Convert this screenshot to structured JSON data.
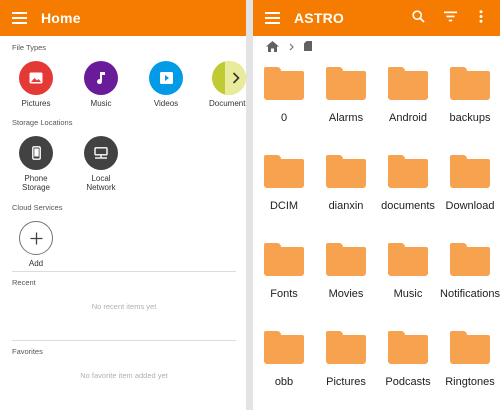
{
  "left_panel": {
    "title": "Home",
    "file_types_label": "File Types",
    "file_types": [
      {
        "label": "Pictures",
        "color": "#e53935",
        "icon": "image-icon"
      },
      {
        "label": "Music",
        "color": "#6a1b9a",
        "icon": "music-note-icon"
      },
      {
        "label": "Videos",
        "color": "#039be5",
        "icon": "play-icon"
      },
      {
        "label": "Documents",
        "color": "#c0ca33",
        "icon": "document-icon"
      }
    ],
    "storage_label": "Storage Locations",
    "storage": [
      {
        "label_line1": "Phone",
        "label_line2": "Storage",
        "icon": "phone-icon"
      },
      {
        "label_line1": "Local",
        "label_line2": "Network",
        "icon": "network-icon"
      }
    ],
    "cloud_label": "Cloud Services",
    "add_label": "Add",
    "recent_label": "Recent",
    "recent_empty": "No recent items yet",
    "favorites_label": "Favorites",
    "favorites_empty": "No favorite item added yet"
  },
  "right_panel": {
    "title": "ASTRO",
    "folders": [
      "0",
      "Alarms",
      "Android",
      "backups",
      "DCIM",
      "dianxin",
      "documents",
      "Download",
      "Fonts",
      "Movies",
      "Music",
      "Notifications",
      "obb",
      "Pictures",
      "Podcasts",
      "Ringtones"
    ]
  },
  "colors": {
    "accent": "#f57c00",
    "folder": "#f6a24f"
  }
}
